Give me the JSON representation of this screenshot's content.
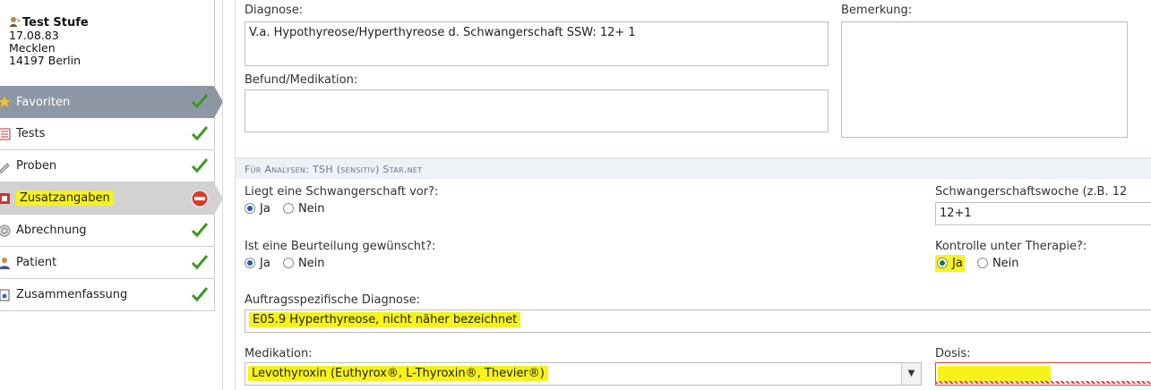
{
  "patient": {
    "name": "Test Stufe",
    "dob": "17.08.83",
    "street": "Mecklen",
    "city": "14197 Berlin"
  },
  "nav": [
    {
      "label": "Favoriten",
      "icon": "star-icon",
      "status": "check"
    },
    {
      "label": "Tests",
      "icon": "list-icon",
      "status": "check"
    },
    {
      "label": "Proben",
      "icon": "pipette-icon",
      "status": "check"
    },
    {
      "label": "Zusatzangaben",
      "icon": "form-icon",
      "status": "stop"
    },
    {
      "label": "Abrechnung",
      "icon": "coin-icon",
      "status": "check"
    },
    {
      "label": "Patient",
      "icon": "person-icon",
      "status": "check"
    },
    {
      "label": "Zusammenfassung",
      "icon": "summary-icon",
      "status": "check"
    }
  ],
  "form": {
    "diagnose_label": "Diagnose:",
    "diagnose_value": "V.a. Hypothyreose/Hyperthyreose  d.  Schwangerschaft  SSW: 12+ 1",
    "bemerkung_label": "Bemerkung:",
    "befund_label": "Befund/Medikation:",
    "section_title": "Für Analysen: TSH (sensitiv) Star.net",
    "schwanger_label": "Liegt eine Schwangerschaft vor?:",
    "beurteilung_label": "Ist eine Beurteilung gewünscht?:",
    "ssw_label": "Schwangerschaftswoche (z.B. 12",
    "ssw_value": "12+1",
    "kontrolle_label": "Kontrolle unter Therapie?:",
    "ja": "Ja",
    "nein": "Nein",
    "auftrag_label": "Auftragsspezifische Diagnose:",
    "auftrag_value": "E05.9 Hyperthyreose, nicht näher bezeichnet",
    "medikation_label": "Medikation:",
    "medikation_value": "Levothyroxin (Euthyrox®, L-Thyroxin®, Thevier®)",
    "dosis_label": "Dosis:"
  },
  "colors": {
    "highlight": "#f6f21a",
    "active_nav": "#8e97a5",
    "check": "#3c9a1e",
    "stop": "#d93b2b"
  }
}
